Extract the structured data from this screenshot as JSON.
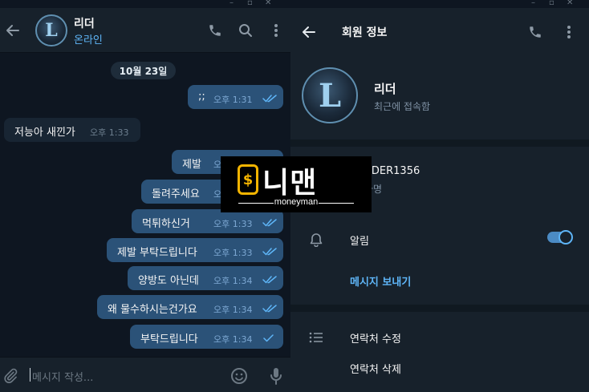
{
  "chat": {
    "name": "리더",
    "status": "온라인",
    "avatar_letter": "L",
    "date_divider": "10월 23일",
    "messages": [
      {
        "dir": "out",
        "text": ";;",
        "time": "오후 1:31",
        "ticks": "double"
      },
      {
        "dir": "in",
        "text": "저능아 새낀가",
        "time": "오후 1:33"
      },
      {
        "dir": "out",
        "text": "제발",
        "time": "오후 1:33",
        "ticks": "double"
      },
      {
        "dir": "out",
        "text": "돌려주세요",
        "time": "오후 1:33",
        "ticks": "double"
      },
      {
        "dir": "out",
        "text": "먹튀하신거",
        "time": "오후 1:33",
        "ticks": "double"
      },
      {
        "dir": "out",
        "text": "제발 부탁드립니다",
        "time": "오후 1:33",
        "ticks": "double"
      },
      {
        "dir": "out",
        "text": "양방도 아닌데",
        "time": "오후 1:34",
        "ticks": "double"
      },
      {
        "dir": "out",
        "text": "왜 물수하시는건가요",
        "time": "오후 1:34",
        "ticks": "double"
      },
      {
        "dir": "out",
        "text": "부탁드립니다",
        "time": "오후 1:34",
        "ticks": "single"
      }
    ],
    "composer_placeholder": "메시지 작성..."
  },
  "profile": {
    "title": "회원 정보",
    "name": "리더",
    "last_seen": "최근에 접속함",
    "avatar_letter": "L",
    "username_value": "ADER1356",
    "username_label": "자명",
    "notifications_label": "알림",
    "notifications_on": true,
    "send_message_label": "메시지 보내기",
    "edit_contact_label": "연락처 수정",
    "delete_contact_label": "연락처 삭제"
  },
  "watermark": {
    "icon_symbol": "$",
    "text": "머니맨",
    "visible_text": "니맨",
    "subtext": "moneyman"
  },
  "colors": {
    "accent": "#5eb5f7",
    "outgoing_bubble": "#2b5278",
    "incoming_bubble": "#182533",
    "panel": "#17212b",
    "chat_bg": "#0e1621"
  }
}
